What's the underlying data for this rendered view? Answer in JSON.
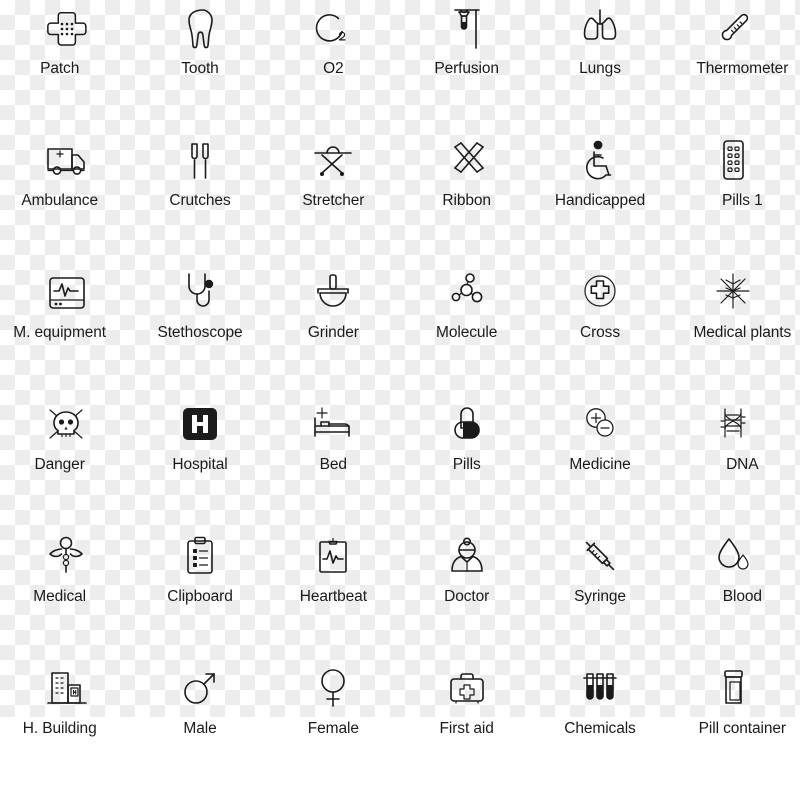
{
  "sheet": {
    "title": "Medical line icon set",
    "columns": 6,
    "rows": 6,
    "background": "transparency-checkerboard",
    "checker_light": "#ffffff",
    "checker_dark": "#ededed",
    "ink_color": "#1b1b1b"
  },
  "icons": [
    {
      "label": "Patch",
      "icon": "bandage-patch-icon"
    },
    {
      "label": "Tooth",
      "icon": "tooth-icon"
    },
    {
      "label": "O2",
      "icon": "oxygen-o2-icon"
    },
    {
      "label": "Perfusion",
      "icon": "iv-drip-perfusion-icon"
    },
    {
      "label": "Lungs",
      "icon": "lungs-icon"
    },
    {
      "label": "Thermometer",
      "icon": "thermometer-icon"
    },
    {
      "label": "Ambulance",
      "icon": "ambulance-icon"
    },
    {
      "label": "Crutches",
      "icon": "crutches-icon"
    },
    {
      "label": "Stretcher",
      "icon": "stretcher-icon"
    },
    {
      "label": "Ribbon",
      "icon": "awareness-ribbon-icon"
    },
    {
      "label": "Handicapped",
      "icon": "wheelchair-handicapped-icon"
    },
    {
      "label": "Pills 1",
      "icon": "pill-blister-pack-icon"
    },
    {
      "label": "M. equipment",
      "icon": "medical-monitor-equipment-icon"
    },
    {
      "label": "Stethoscope",
      "icon": "stethoscope-icon"
    },
    {
      "label": "Grinder",
      "icon": "mortar-grinder-icon"
    },
    {
      "label": "Molecule",
      "icon": "molecule-icon"
    },
    {
      "label": "Cross",
      "icon": "medical-cross-circle-icon"
    },
    {
      "label": "Medical plants",
      "icon": "medical-plants-star-icon"
    },
    {
      "label": "Danger",
      "icon": "skull-danger-icon"
    },
    {
      "label": "Hospital",
      "icon": "hospital-h-sign-icon"
    },
    {
      "label": "Bed",
      "icon": "hospital-bed-icon"
    },
    {
      "label": "Pills",
      "icon": "pills-capsule-icon"
    },
    {
      "label": "Medicine",
      "icon": "plus-minus-medicine-icon"
    },
    {
      "label": "DNA",
      "icon": "dna-icon"
    },
    {
      "label": "Medical",
      "icon": "caduceus-medical-icon"
    },
    {
      "label": "Clipboard",
      "icon": "clipboard-checklist-icon"
    },
    {
      "label": "Heartbeat",
      "icon": "heartbeat-chart-icon"
    },
    {
      "label": "Doctor",
      "icon": "doctor-icon"
    },
    {
      "label": "Syringe",
      "icon": "syringe-icon"
    },
    {
      "label": "Blood",
      "icon": "blood-drop-icon"
    },
    {
      "label": "H. Building",
      "icon": "hospital-building-icon"
    },
    {
      "label": "Male",
      "icon": "male-gender-icon"
    },
    {
      "label": "Female",
      "icon": "female-gender-icon"
    },
    {
      "label": "First aid",
      "icon": "first-aid-kit-icon"
    },
    {
      "label": "Chemicals",
      "icon": "test-tubes-chemicals-icon"
    },
    {
      "label": "Pill container",
      "icon": "pill-container-icon"
    }
  ]
}
